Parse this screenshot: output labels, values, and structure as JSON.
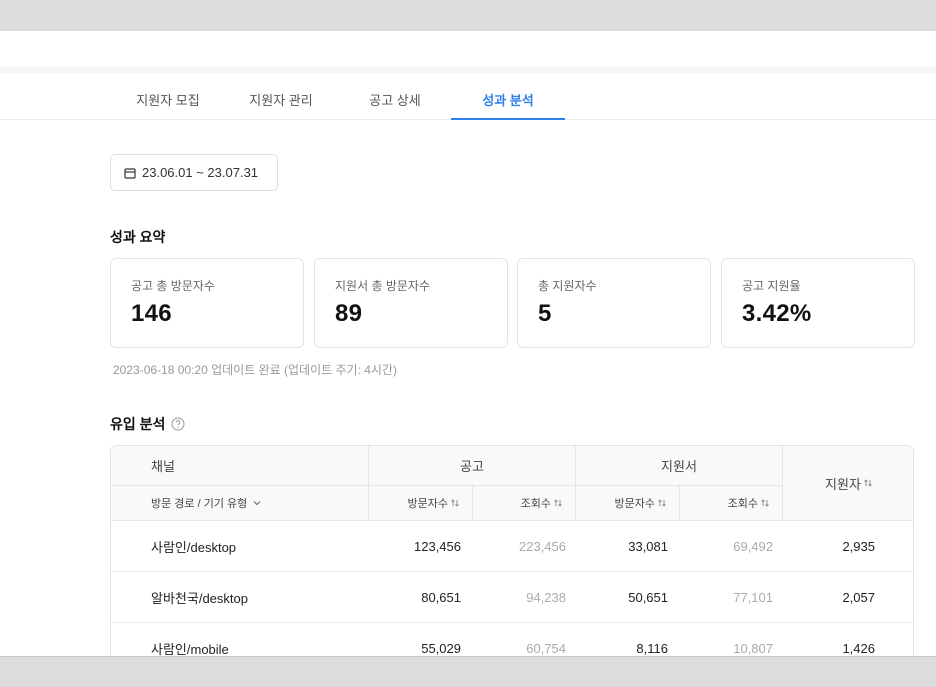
{
  "tabs": [
    {
      "label": "지원자 모집"
    },
    {
      "label": "지원자 관리"
    },
    {
      "label": "공고 상세"
    },
    {
      "label": "성과 분석"
    }
  ],
  "date_range": "23.06.01 ~ 23.07.31",
  "summary": {
    "title": "성과 요약",
    "cards": [
      {
        "label": "공고 총 방문자수",
        "value": "146"
      },
      {
        "label": "지원서 총 방문자수",
        "value": "89"
      },
      {
        "label": "총 지원자수",
        "value": "5"
      },
      {
        "label": "공고 지원율",
        "value": "3.42%"
      }
    ],
    "update_note": "2023-06-18 00:20 업데이트 완료 (업데이트 주기: 4시간)"
  },
  "inflow": {
    "title": "유입 분석",
    "headers": {
      "channel": "채널",
      "posting": "공고",
      "application": "지원서",
      "applicants": "지원자",
      "route": "방문 경로 / 기기 유형",
      "visitors": "방문자수",
      "views": "조회수"
    },
    "rows": [
      {
        "channel": "사람인/desktop",
        "posting_visitors": "123,456",
        "posting_views": "223,456",
        "app_visitors": "33,081",
        "app_views": "69,492",
        "applicants": "2,935"
      },
      {
        "channel": "알바천국/desktop",
        "posting_visitors": "80,651",
        "posting_views": "94,238",
        "app_visitors": "50,651",
        "app_views": "77,101",
        "applicants": "2,057"
      },
      {
        "channel": "사람인/mobile",
        "posting_visitors": "55,029",
        "posting_views": "60,754",
        "app_visitors": "8,116",
        "app_views": "10,807",
        "applicants": "1,426"
      }
    ]
  },
  "colors": {
    "accent": "#2f80ed",
    "muted": "#aaaaaa"
  }
}
